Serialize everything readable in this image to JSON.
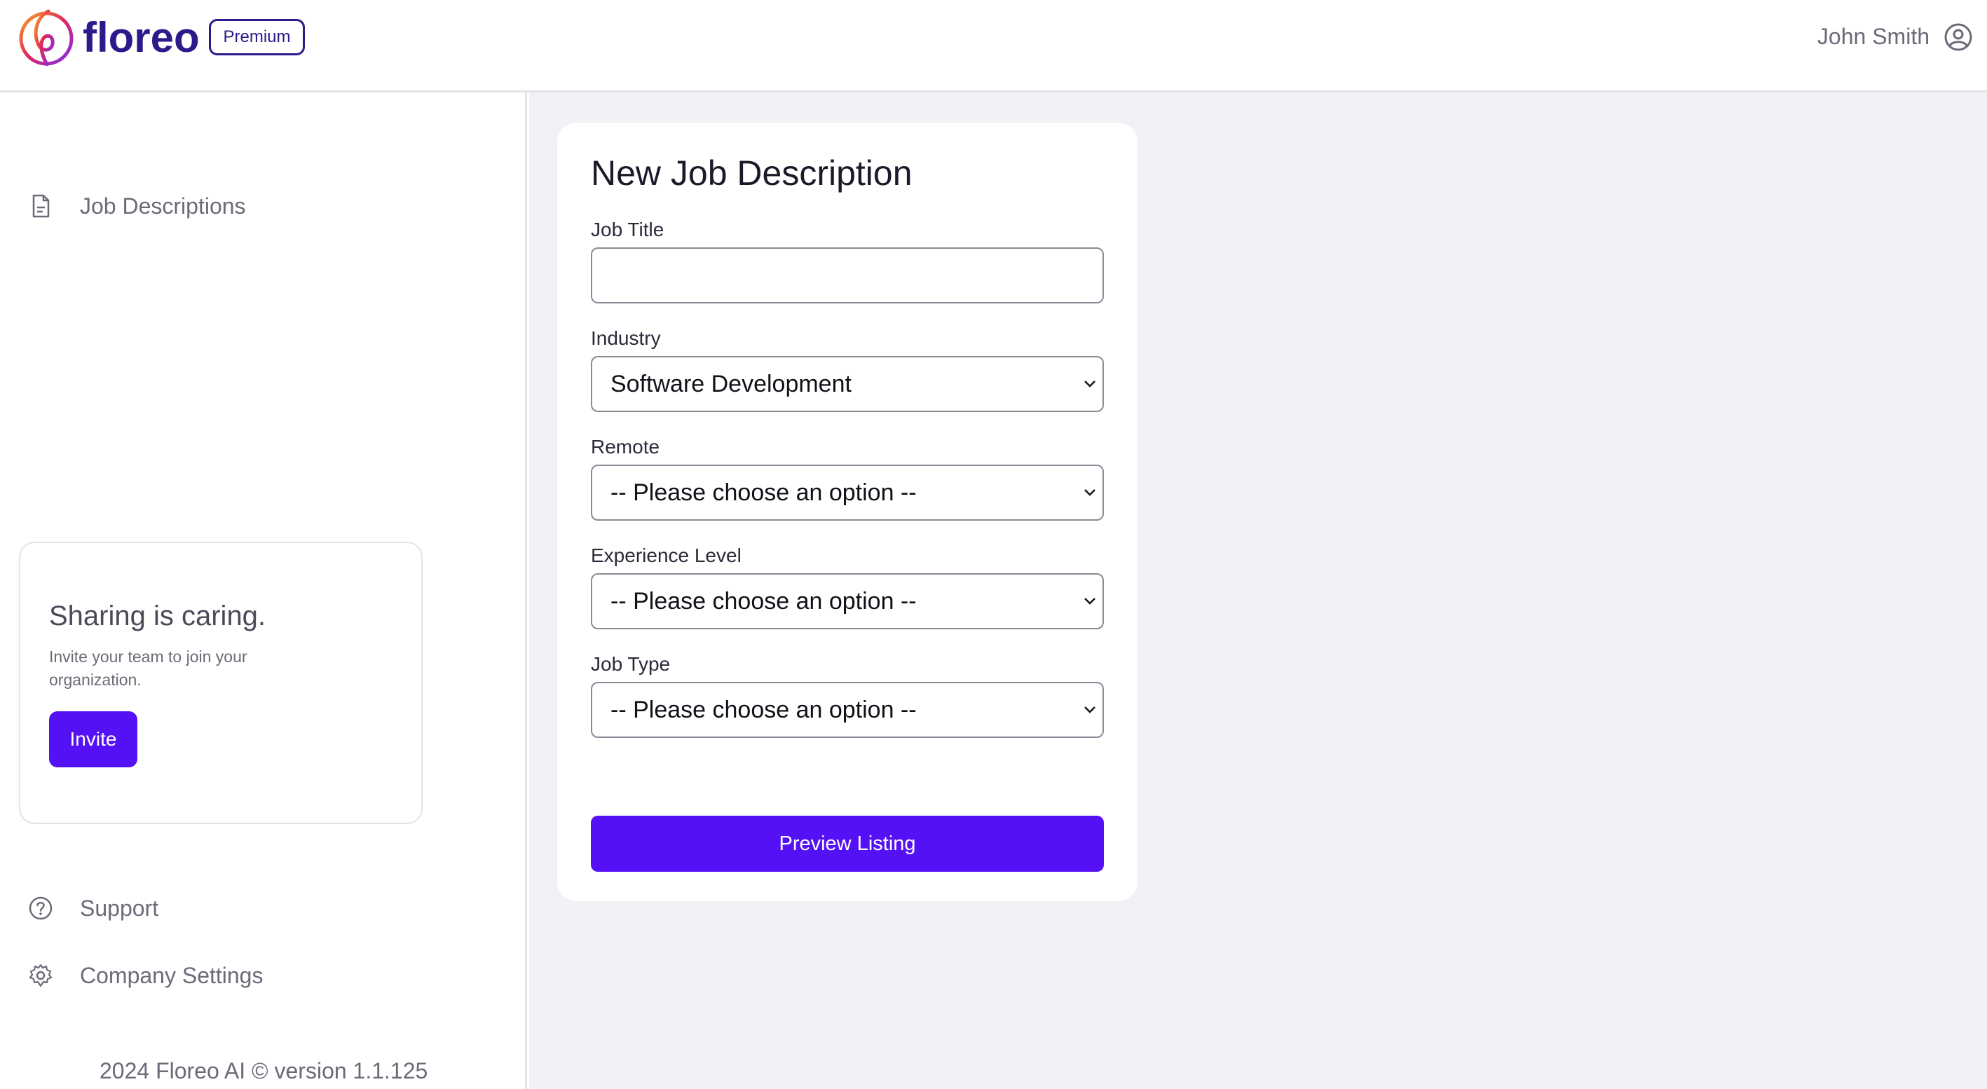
{
  "header": {
    "brand": "floreo",
    "plan_badge": "Premium",
    "user_name": "John Smith"
  },
  "sidebar": {
    "nav_top": [
      {
        "label": "Job Descriptions",
        "icon": "document-icon"
      }
    ],
    "invite_card": {
      "title": "Sharing is caring.",
      "description": "Invite your team to join your organization.",
      "button_label": "Invite"
    },
    "nav_bottom": [
      {
        "label": "Support",
        "icon": "help-circle-icon"
      },
      {
        "label": "Company Settings",
        "icon": "gear-icon"
      }
    ],
    "footer": "2024 Floreo AI © version 1.1.125"
  },
  "form": {
    "title": "New Job Description",
    "fields": [
      {
        "label": "Job Title",
        "type": "text",
        "value": ""
      },
      {
        "label": "Industry",
        "type": "select",
        "value": "Software Development"
      },
      {
        "label": "Remote",
        "type": "select",
        "value": "-- Please choose an option --"
      },
      {
        "label": "Experience Level",
        "type": "select",
        "value": "-- Please choose an option --"
      },
      {
        "label": "Job Type",
        "type": "select",
        "value": "-- Please choose an option --"
      }
    ],
    "submit_label": "Preview Listing"
  },
  "colors": {
    "accent": "#5511f5",
    "brand": "#2b1a8a",
    "main_background": "#f2f1f6"
  }
}
